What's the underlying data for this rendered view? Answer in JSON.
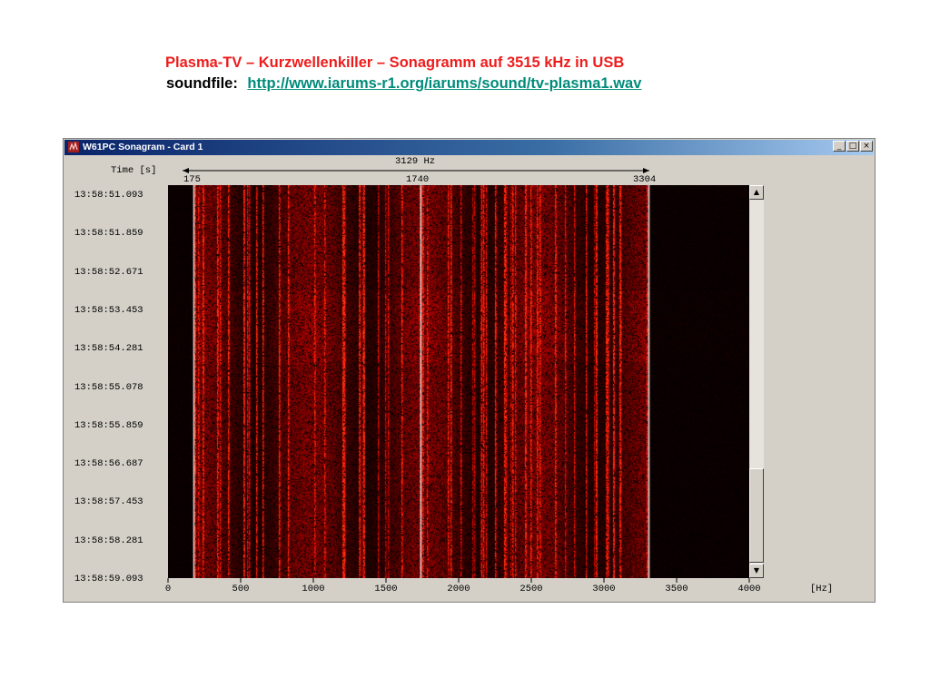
{
  "slide": {
    "title": "Plasma-TV – Kurzwellenkiller –  Sonagramm auf 3515 kHz in USB",
    "soundfile_label": "soundfile:",
    "soundfile_link": "http://www.iarums-r1.org/iarums/sound/tv-plasma1.wav"
  },
  "window": {
    "title": "W61PC Sonagram  - Card 1",
    "controls": {
      "minimize": "_",
      "maximize": "□",
      "close": "×"
    }
  },
  "sonagram": {
    "time_axis_label": "Time [s]",
    "bandwidth_label": "3129 Hz",
    "marker_left": "175",
    "marker_center": "1740",
    "marker_right": "3304",
    "time_labels": [
      "13:58:51.093",
      "13:58:51.859",
      "13:58:52.671",
      "13:58:53.453",
      "13:58:54.281",
      "13:58:55.078",
      "13:58:55.859",
      "13:58:56.687",
      "13:58:57.453",
      "13:58:58.281",
      "13:58:59.093"
    ],
    "freq_ticks": [
      "0",
      "500",
      "1000",
      "1500",
      "2000",
      "2500",
      "3000",
      "3500",
      "4000"
    ],
    "freq_unit": "[Hz]",
    "freq_range_hz": [
      0,
      4000
    ],
    "marker_values_hz": [
      175,
      1740,
      3304
    ],
    "signal_range_hz": [
      175,
      3304
    ],
    "colors": {
      "background": "#000000",
      "signal": "#ff2a10",
      "marker": "#e8e8e8"
    }
  },
  "scrollbar": {
    "up": "▲",
    "down": "▼"
  }
}
